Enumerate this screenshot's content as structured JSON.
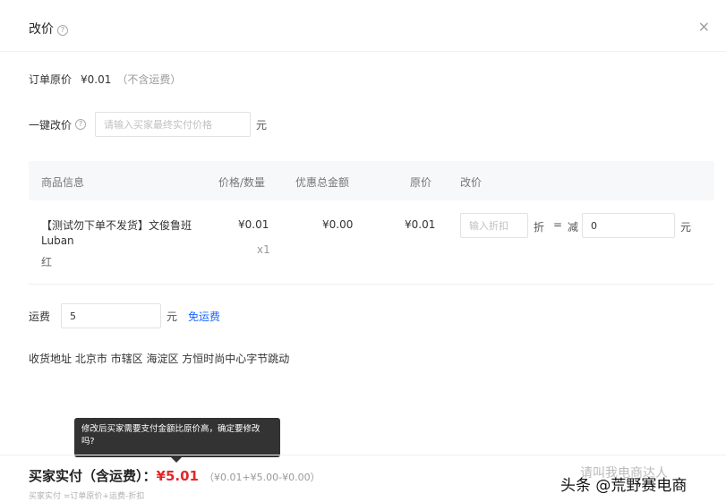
{
  "header": {
    "title": "改价",
    "help_icon": "?",
    "close_icon": "×"
  },
  "original_price": {
    "label": "订单原价",
    "amount": "¥0.01",
    "note": "（不含运费）"
  },
  "one_key": {
    "label": "一键改价",
    "help_icon": "?",
    "placeholder": "请输入买家最终实付价格",
    "unit": "元"
  },
  "table": {
    "headers": [
      "商品信息",
      "价格/数量",
      "优惠总金额",
      "原价",
      "改价"
    ],
    "row": {
      "name": "【测试勿下单不发货】文俊鲁班Luban",
      "spec": "红",
      "price": "¥0.01",
      "qty": "x1",
      "discount_total": "¥0.00",
      "original": "¥0.01",
      "discount_placeholder": "输入折扣",
      "zhe": "折",
      "equals": "=",
      "minus": "减",
      "minus_value": "0",
      "unit": "元"
    }
  },
  "freight": {
    "label": "运费",
    "value": "5",
    "unit": "元",
    "free_link": "免运费"
  },
  "address": {
    "text": "收货地址 北京市 市辖区 海淀区 方恒时尚中心字节跳动"
  },
  "tooltip": {
    "text": "修改后买家需要支付金额比原价高，确定要修改吗?"
  },
  "footer": {
    "pay_label": "买家实付（含运费）：",
    "pay_amount": "¥5.01",
    "breakdown": "（¥0.01+¥5.00-¥0.00）",
    "formula": "买家实付 =订单原价+运费-折扣"
  },
  "watermark": {
    "faint": "请叫我电商达人",
    "main": "头条 @荒野赛电商"
  }
}
